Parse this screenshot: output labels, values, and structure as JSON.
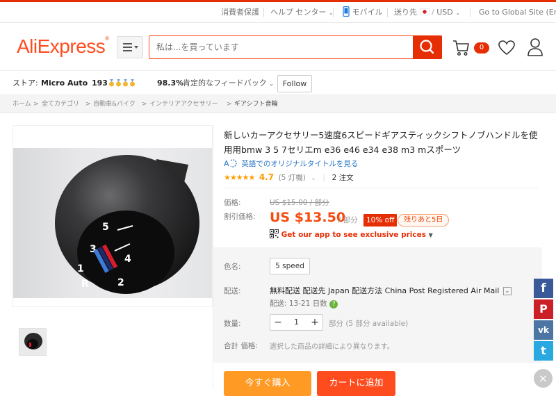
{
  "topbar": {
    "consumer": "消費者保護",
    "help": "ヘルプ センター",
    "mobile": "モバイル",
    "ship_to": "送り先",
    "currency": "USD",
    "global": "Go to Global Site (English)"
  },
  "header": {
    "logo": "AliExpress",
    "search_placeholder": "私は...を買っています",
    "cart_count": "0"
  },
  "store": {
    "label": "ストア:",
    "name": "Micro Auto",
    "score": "193",
    "feedback_pct": "98.3%",
    "feedback_label": "肯定的なフィードバック",
    "follow": "Follow"
  },
  "breadcrumb": {
    "items": [
      "ホーム",
      "全てカテゴリ",
      "自動車&バイク",
      "インテリアアクセサリー",
      "ギアシフト音輪"
    ]
  },
  "product": {
    "title": "新しいカーアクセサリー5速度6スピードギアスティックシフトノブハンドルを使用用bmw 3 5 7セリエm e36 e46 e34 e38 m3 mスポーツ",
    "translate_link": "英語でのオリジナルタイトルを見る",
    "stars": "★★★★★",
    "rating": "4.7",
    "votes": "(5 灯機)",
    "orders": "2 注文",
    "price_label": "価格:",
    "original_price": "US $15.00 / 部分",
    "discount_label": "割引価格:",
    "sale_price": "US $13.50",
    "per_unit": "/ 部分",
    "off_badge": "10% off",
    "days_left": "残りあと5日",
    "app_link": "Get our app to see exclusive prices",
    "color_label": "色名:",
    "color_option": "5 speed",
    "shipping_label": "配送:",
    "shipping_text": "無料配送 配送先 Japan 配送方法 China Post Registered Air Mail",
    "delivery_text": "配送: 13-21 日数",
    "qty_label": "数量:",
    "qty_value": "1",
    "availability": "部分 (5 部分 available)",
    "total_label": "合計 価格:",
    "total_note": "選択した商品の詳細により異なります。",
    "buy_now": "今すぐ購入",
    "add_to_cart": "カートに追加"
  },
  "social": {
    "facebook": "f",
    "pinterest": "P",
    "vk": "vk",
    "twitter": "t",
    "close": "×"
  }
}
